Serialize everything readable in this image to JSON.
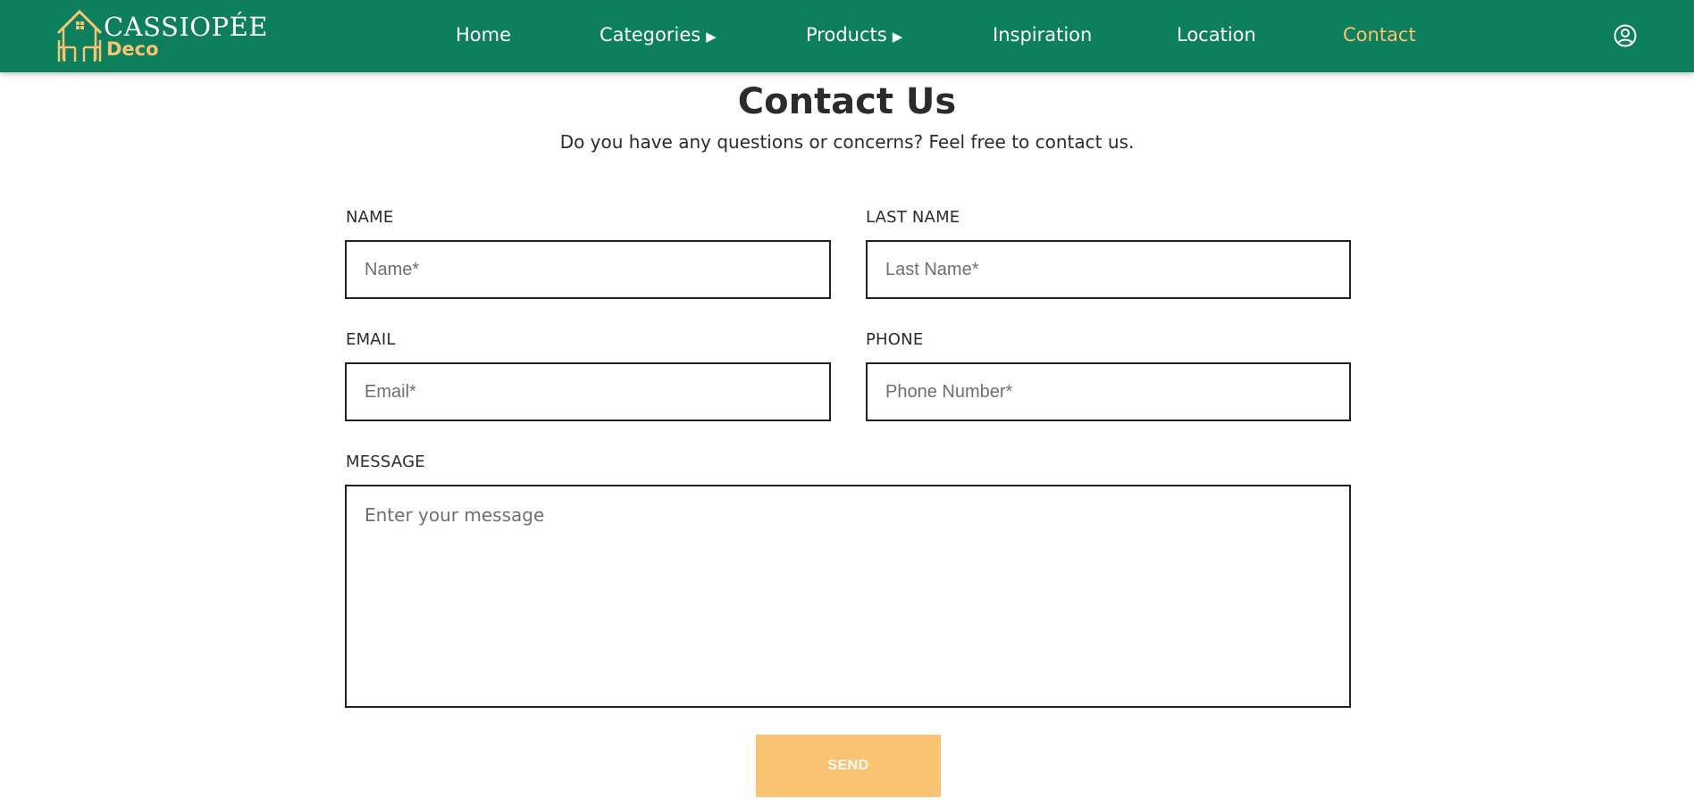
{
  "brand": {
    "name": "CASSIOPÉE",
    "subtitle": "Deco",
    "icon": "house-chairs-logo"
  },
  "nav": {
    "items": [
      {
        "label": "Home",
        "has_arrow": false,
        "active": false
      },
      {
        "label": "Categories",
        "has_arrow": true,
        "active": false
      },
      {
        "label": "Products",
        "has_arrow": true,
        "active": false
      },
      {
        "label": "Inspiration",
        "has_arrow": false,
        "active": false
      },
      {
        "label": "Location",
        "has_arrow": false,
        "active": false
      },
      {
        "label": "Contact",
        "has_arrow": false,
        "active": true
      }
    ],
    "arrow_glyph": "▶",
    "user_icon": "user-circle-icon"
  },
  "page": {
    "title": "Contact Us",
    "subtitle": "Do you have any questions or concerns? Feel free to contact us."
  },
  "form": {
    "name": {
      "label": "NAME",
      "placeholder": "Name*",
      "value": ""
    },
    "last_name": {
      "label": "LAST NAME",
      "placeholder": "Last Name*",
      "value": ""
    },
    "email": {
      "label": "EMAIL",
      "placeholder": "Email*",
      "value": ""
    },
    "phone": {
      "label": "PHONE",
      "placeholder": "Phone Number*",
      "value": ""
    },
    "message": {
      "label": "MESSAGE",
      "placeholder": "Enter your message",
      "value": ""
    },
    "send_label": "SEND"
  },
  "colors": {
    "navbar_bg": "#0d7f5c",
    "accent": "#f7c470",
    "send_button": "#f9c373",
    "text": "#2b2b2b"
  }
}
